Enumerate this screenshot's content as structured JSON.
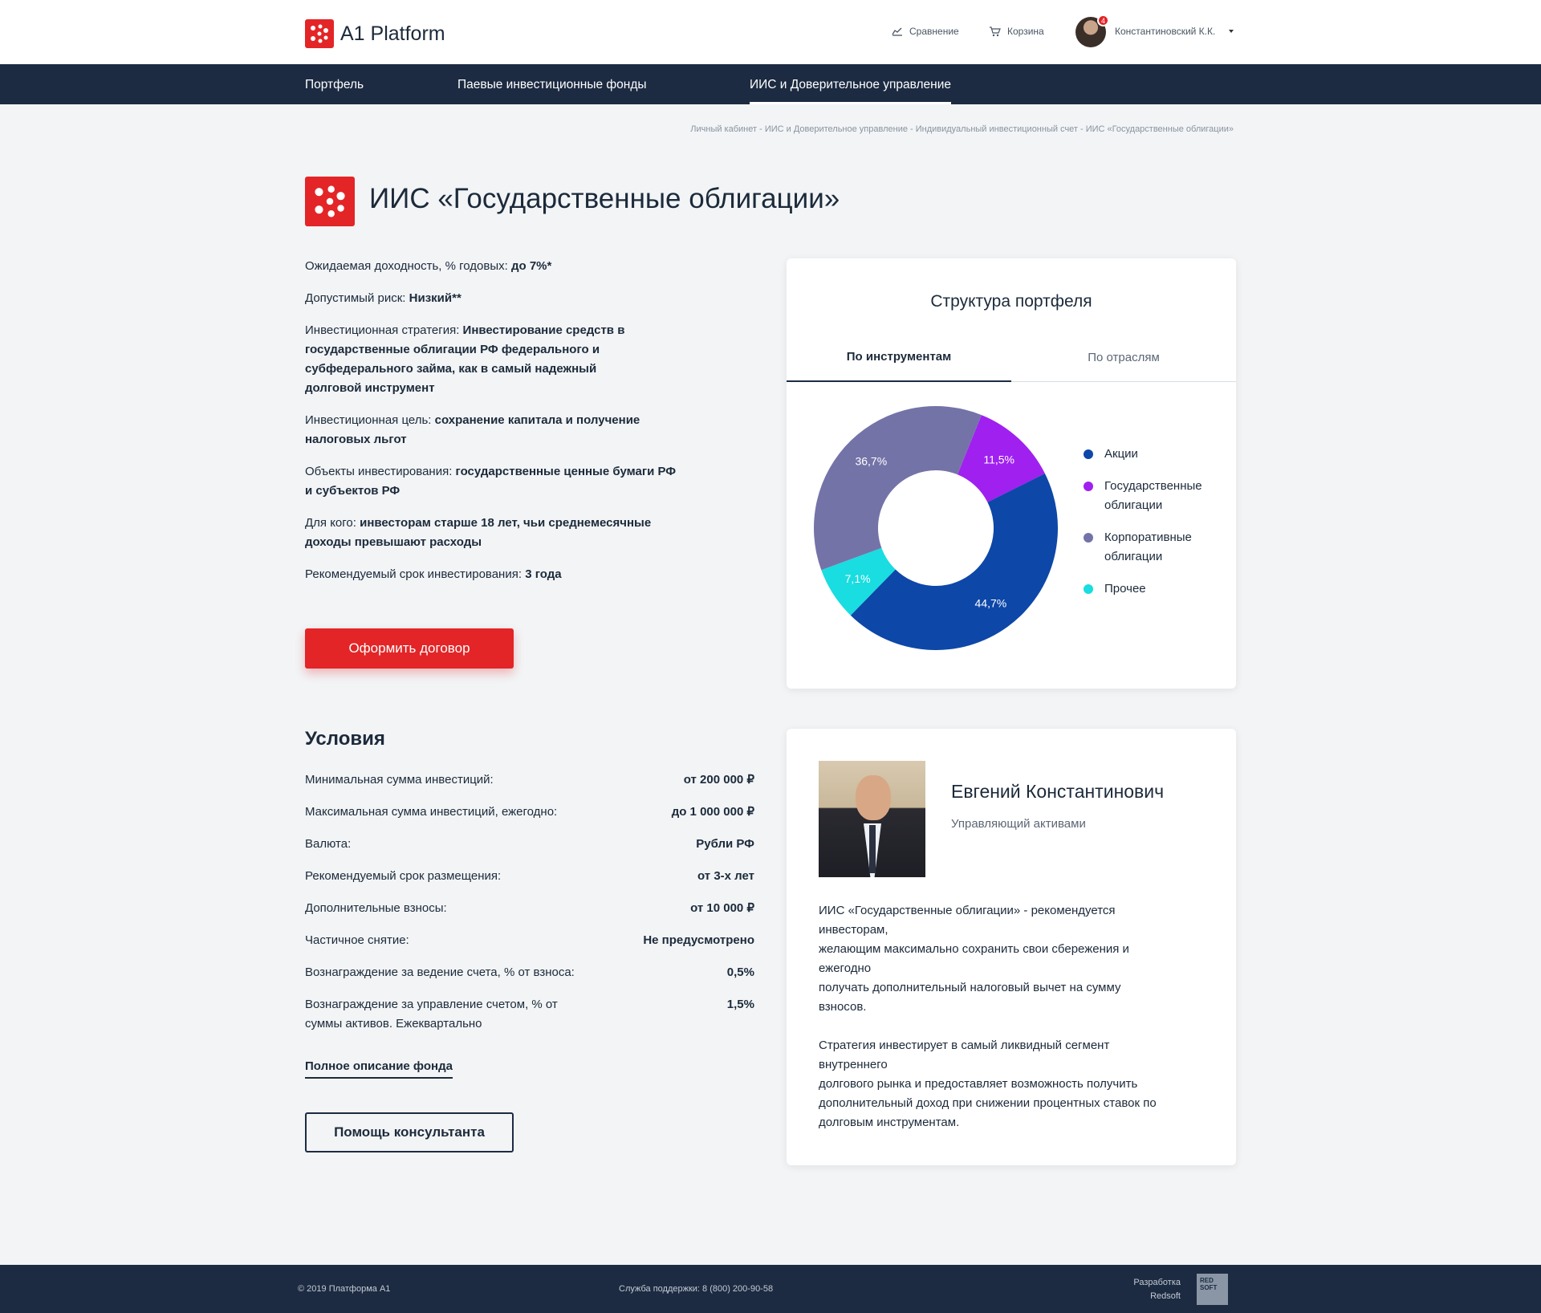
{
  "header": {
    "logo_text": "A1 Platform",
    "compare": "Сравнение",
    "cart": "Корзина",
    "user_name": "Константиновский К.К.",
    "notifications": "4"
  },
  "nav": {
    "items": [
      {
        "label": "Портфель"
      },
      {
        "label": "Паевые инвестиционные фонды"
      },
      {
        "label": "ИИС и Доверительное управление"
      }
    ]
  },
  "breadcrumb": "Личный кабинет - ИИС и Доверительное управление - Индивидуальный инвестиционный счет - ИИС «Государственные облигации»",
  "title": "ИИС «Государственные облигации»",
  "info": [
    {
      "label": "Ожидаемая доходность, % годовых: ",
      "value": "до 7%*"
    },
    {
      "label": "Допустимый риск: ",
      "value": "Низкий**"
    },
    {
      "label": "Инвестиционная стратегия: ",
      "value": "Инвестирование средств в государственные облигации РФ федерального и субфедерального займа, как в самый надежный долговой инструмент"
    },
    {
      "label": "Инвестиционная цель: ",
      "value": "сохранение капитала и получение налоговых льгот"
    },
    {
      "label": "Объекты инвестирования: ",
      "value": "государственные ценные бумаги РФ и субъектов РФ"
    },
    {
      "label": "Для кого: ",
      "value": "инвесторам старше 18 лет, чьи среднемесячные доходы превышают расходы"
    },
    {
      "label": "Рекомендуемый срок инвестирования: ",
      "value": "3 года"
    }
  ],
  "contract_button": "Оформить договор",
  "portfolio": {
    "title": "Структура портфеля",
    "tabs": [
      {
        "label": "По инструментам"
      },
      {
        "label": "По отраслям"
      }
    ]
  },
  "chart_data": {
    "type": "pie",
    "title": "Структура портфеля",
    "series": [
      {
        "name": "Акции",
        "value": 44.7,
        "label": "44,7%",
        "color": "#0d47a8"
      },
      {
        "name": "Государственные облигации",
        "value": 11.5,
        "label": "11,5%",
        "color": "#a020f0"
      },
      {
        "name": "Корпоративные облигации",
        "value": 36.7,
        "label": "36,7%",
        "color": "#7473a8"
      },
      {
        "name": "Прочее",
        "value": 7.1,
        "label": "7,1%",
        "color": "#19dde0"
      }
    ],
    "legend": "right"
  },
  "conditions": {
    "title": "Условия",
    "rows": [
      {
        "label": "Минимальная сумма инвестиций:",
        "value": "от 200 000 ₽"
      },
      {
        "label": "Максимальная сумма инвестиций,  ежегодно:",
        "value": "до 1 000 000  ₽"
      },
      {
        "label": "Валюта:",
        "value": "Рубли РФ"
      },
      {
        "label": "Рекомендуемый срок размещения:",
        "value": "от 3-х лет"
      },
      {
        "label": "Дополнительные взносы:",
        "value": "от 10 000 ₽"
      },
      {
        "label": "Частичное снятие:",
        "value": "Не предусмотрено"
      },
      {
        "label": "Вознаграждение за ведение счета, % от взноса:",
        "value": "0,5%"
      },
      {
        "label": "Вознаграждение за управление счетом, % от суммы активов. Ежеквартально",
        "value": "1,5%"
      }
    ],
    "full_link": "Полное описание фонда",
    "consult_button": "Помощь консультанта"
  },
  "manager": {
    "name": "Евгений Константинович",
    "role": "Управляющий активами",
    "p1_lines": [
      "ИИС «Государственные  облигации» - рекомендуется инвесторам,",
      "желающим максимально сохранить свои сбережения и ежегодно",
      "получать дополнительный налоговый вычет на сумму взносов."
    ],
    "p2_lines": [
      "Стратегия инвестирует в самый ликвидный сегмент внутреннего",
      "долгового рынка и предоставляет возможность  получить",
      "дополнительный доход при снижении процентных ставок по",
      "долговым инструментам."
    ]
  },
  "footer": {
    "copyright": "© 2019  Платформа А1",
    "support": "Служба поддержки:   8 (800) 200-90-58",
    "dev_label": "Разработка",
    "dev_name": "Redsoft",
    "dev_logo": "RED SOFT"
  }
}
